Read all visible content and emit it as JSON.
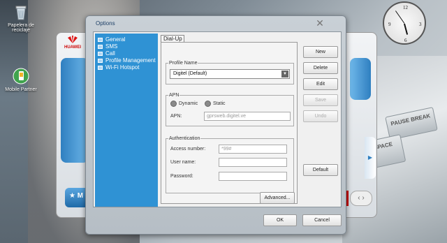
{
  "desktop": {
    "icons": [
      {
        "label": "Papelera de reciclaje",
        "icon": "recycle-bin-icon"
      },
      {
        "label": "Mobile Partner",
        "icon": "mobile-partner-icon"
      }
    ],
    "keys": [
      "PAUSE BREAK",
      "BACK SPACE"
    ]
  },
  "huawei": {
    "logo": "HUAWEI",
    "bottom_label": "M"
  },
  "dialog": {
    "title": "Options",
    "nav": [
      "General",
      "SMS",
      "Call",
      "Profile Management",
      "Wi-Fi Hotspot"
    ],
    "tab": "Dial-Up",
    "profile": {
      "legend": "Profile Name",
      "selected": "Digitel (Default)"
    },
    "apn": {
      "legend": "APN",
      "dynamic": "Dynamic",
      "static": "Static",
      "label": "APN:",
      "value": "gprsweb.digitel.ve"
    },
    "auth": {
      "legend": "Authentication",
      "access_label": "Access number:",
      "access_value": "*99#",
      "user_label": "User name:",
      "pass_label": "Password:"
    },
    "advanced": "Advanced...",
    "buttons": {
      "new": "New",
      "delete": "Delete",
      "edit": "Edit",
      "save": "Save",
      "undo": "Undo",
      "default": "Default"
    },
    "ok": "OK",
    "cancel": "Cancel"
  }
}
